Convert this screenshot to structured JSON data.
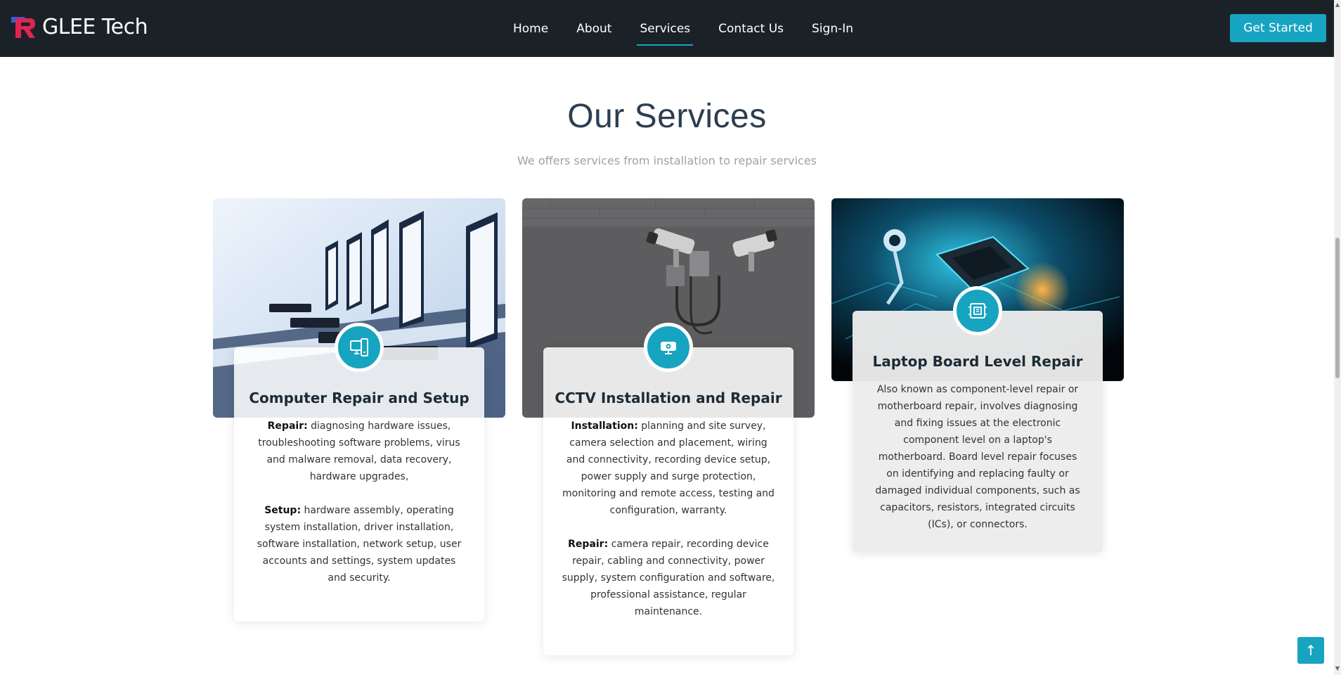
{
  "brand": {
    "name": "GLEE Tech"
  },
  "nav": [
    {
      "label": "Home"
    },
    {
      "label": "About"
    },
    {
      "label": "Services",
      "active": true
    },
    {
      "label": "Contact Us"
    },
    {
      "label": "Sign-In"
    }
  ],
  "header": {
    "cta_label": "Get Started"
  },
  "section": {
    "title": "Our Services",
    "subtitle": "We offers services from installation to repair services"
  },
  "services": [
    {
      "title": "Computer Repair and Setup",
      "icon": "computer-icon",
      "image": "computer-lab-image",
      "paragraphs": [
        {
          "bold": "Repair:",
          "text": " diagnosing hardware issues, troubleshooting software problems, virus and malware removal, data recovery, hardware upgrades,"
        },
        {
          "bold": "Setup:",
          "text": " hardware assembly, operating system installation, driver installation, software installation, network setup, user accounts and settings, system updates and security."
        }
      ]
    },
    {
      "title": "CCTV Installation and Repair",
      "icon": "cctv-icon",
      "image": "cctv-cameras-image",
      "paragraphs": [
        {
          "bold": "Installation:",
          "text": " planning and site survey, camera selection and placement, wiring and connectivity, recording device setup, power supply and surge protection, monitoring and remote access, testing and configuration, warranty."
        },
        {
          "bold": "Repair:",
          "text": " camera repair, recording device repair, cabling and connectivity, power supply, system configuration and software, professional assistance, regular maintenance."
        }
      ]
    },
    {
      "title": "Laptop Board Level Repair",
      "icon": "circuit-board-icon",
      "image": "circuit-board-image",
      "paragraphs": [
        {
          "bold": "",
          "text": "Also known as component-level repair or motherboard repair, involves diagnosing and fixing issues at the electronic component level on a laptop's motherboard. Board level repair focuses on identifying and replacing faulty or damaged individual components, such as capacitors, resistors, integrated circuits (ICs), or connectors."
        }
      ]
    }
  ],
  "colors": {
    "accent": "#16a4c1",
    "header_bg": "#1b2227",
    "title": "#2c3e50"
  },
  "back_to_top_icon": "arrow-up-icon"
}
